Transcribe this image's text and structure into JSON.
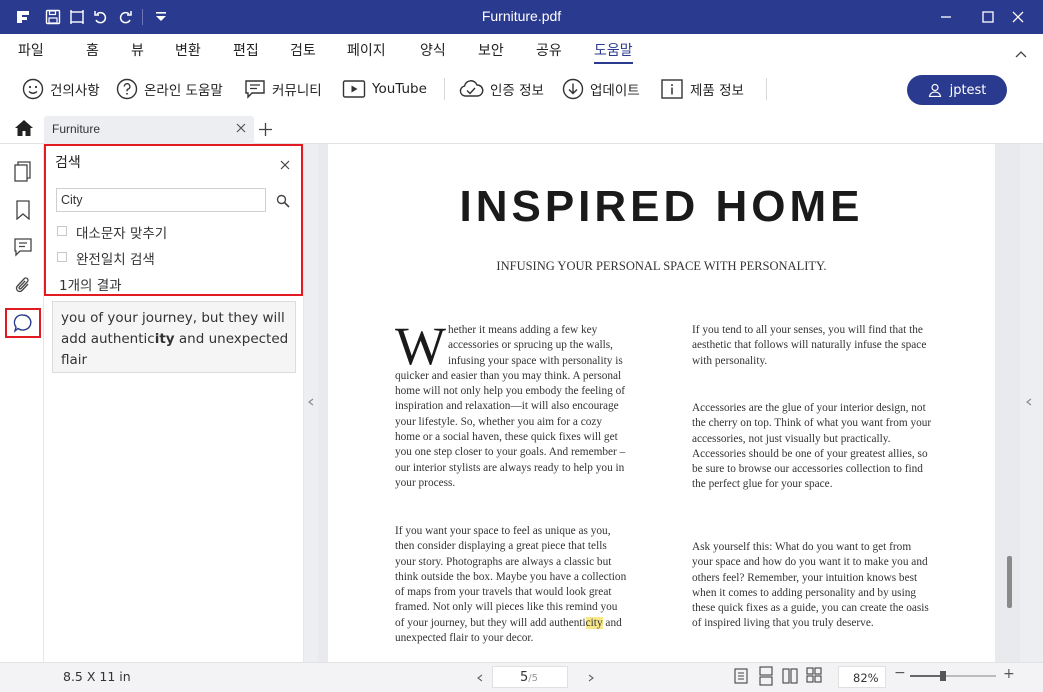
{
  "window": {
    "title": "Furniture.pdf"
  },
  "menu": [
    "파일",
    "홈",
    "뷰",
    "변환",
    "편집",
    "검토",
    "페이지",
    "양식",
    "보안",
    "공유",
    "도움말"
  ],
  "toolbar": {
    "feedback": "건의사항",
    "online_help": "온라인 도움말",
    "community": "커뮤니티",
    "youtube": "YouTube",
    "auth_info": "인증 정보",
    "update": "업데이트",
    "product_info": "제품 정보",
    "user": "jptest"
  },
  "tab": {
    "label": "Furniture"
  },
  "search": {
    "title": "검색",
    "query": "City",
    "match_case": "대소문자 맞추기",
    "whole_word": "완전일치 검색",
    "result_count": "1개의 결과",
    "result_pre": " you of your journey, but they will add authentic",
    "result_match": "ity",
    "result_post": " and unexpected flair"
  },
  "document": {
    "heading": "INSPIRED HOME",
    "subheading": "INFUSING YOUR PERSONAL SPACE WITH PERSONALITY.",
    "dropcap": "W",
    "col1_p1": "hether it means adding a few key accessories or sprucing up the walls, infusing your space with personality is quicker and easier than you may think. A personal home will not only help you embody the feeling of inspiration and relaxation—it will also encourage your lifestyle. So, whether you aim for a cozy home or a social haven, these quick fixes will get you one step closer to your goals. And remember – our interior stylists are always ready to help you in your process.",
    "col1_p2_pre": "If you want your space to feel as unique as you, then consider displaying a great piece that tells your story. Photographs are always a classic but think outside the box. Maybe you have a collection of maps from your travels that would look great framed. Not only will pieces like this remind you of your journey, but they will add authenti",
    "col1_p2_match": "city",
    "col1_p2_post": " and unexpected flair to your decor.",
    "col2_p1": "If you tend to all your senses, you will find that the aesthetic that follows will naturally infuse the space with personality.",
    "col2_p2": "Accessories are the glue of your interior design, not the cherry on top. Think of what you want from your accessories, not just visually but practically. Accessories should be one of your greatest allies, so be sure to browse our accessories collection to find the perfect glue for your space.",
    "col2_p3": "Ask yourself this: What do you want to get from your space and how do you want it to make you and others feel? Remember, your intuition knows best when it comes to adding personality and by using these quick fixes as a guide, you can create the oasis of inspired living that you truly deserve."
  },
  "status": {
    "page_size": "8.5 X 11 in",
    "current_page": "5",
    "total_pages": "/5",
    "zoom": "82%"
  },
  "colors": {
    "accent": "#2a3a8e",
    "highlight_border": "#e21b23",
    "search_highlight": "#f7e88a"
  }
}
